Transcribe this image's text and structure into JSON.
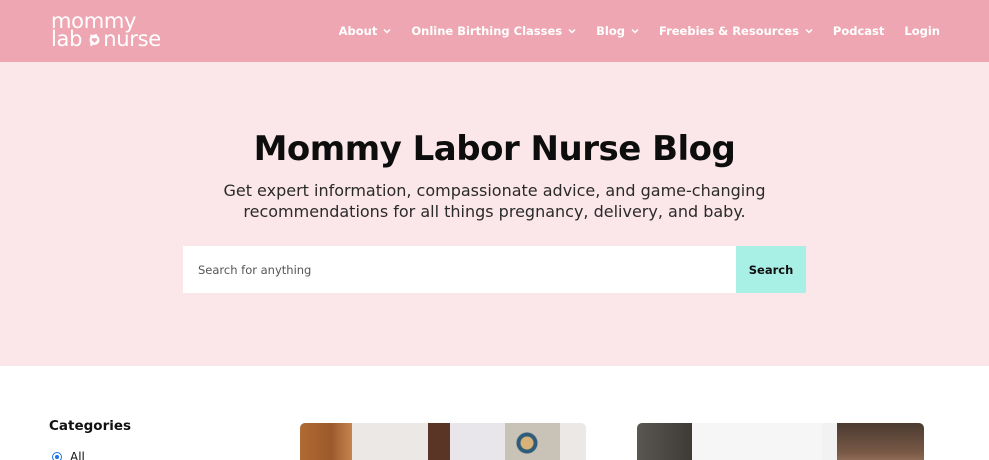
{
  "brand": {
    "line1": "mommy",
    "line2": "lab  r nurse",
    "color": "#ffffff"
  },
  "nav": {
    "items": [
      {
        "label": "About",
        "has_dropdown": true
      },
      {
        "label": "Online Birthing Classes",
        "has_dropdown": true
      },
      {
        "label": "Blog",
        "has_dropdown": true
      },
      {
        "label": "Freebies & Resources",
        "has_dropdown": true
      },
      {
        "label": "Podcast",
        "has_dropdown": false
      },
      {
        "label": "Login",
        "has_dropdown": false
      }
    ]
  },
  "hero": {
    "title": "Mommy Labor Nurse Blog",
    "subtitle_line1": "Get expert information, compassionate advice, and game-changing",
    "subtitle_line2": "recommendations for all things pregnancy, delivery, and baby."
  },
  "search": {
    "placeholder": "Search for anything",
    "value": "",
    "button_label": "Search"
  },
  "sidebar": {
    "categories_title": "Categories",
    "items": [
      {
        "label": "All",
        "selected": true
      }
    ]
  },
  "colors": {
    "header_bg": "#eea7b2",
    "hero_bg": "#fbe7ea",
    "search_button_bg": "#a8efe6",
    "radio_accent": "#1a73e8"
  },
  "icons": {
    "logo_heart": "heart-icon",
    "dropdown": "chevron-down-icon"
  }
}
